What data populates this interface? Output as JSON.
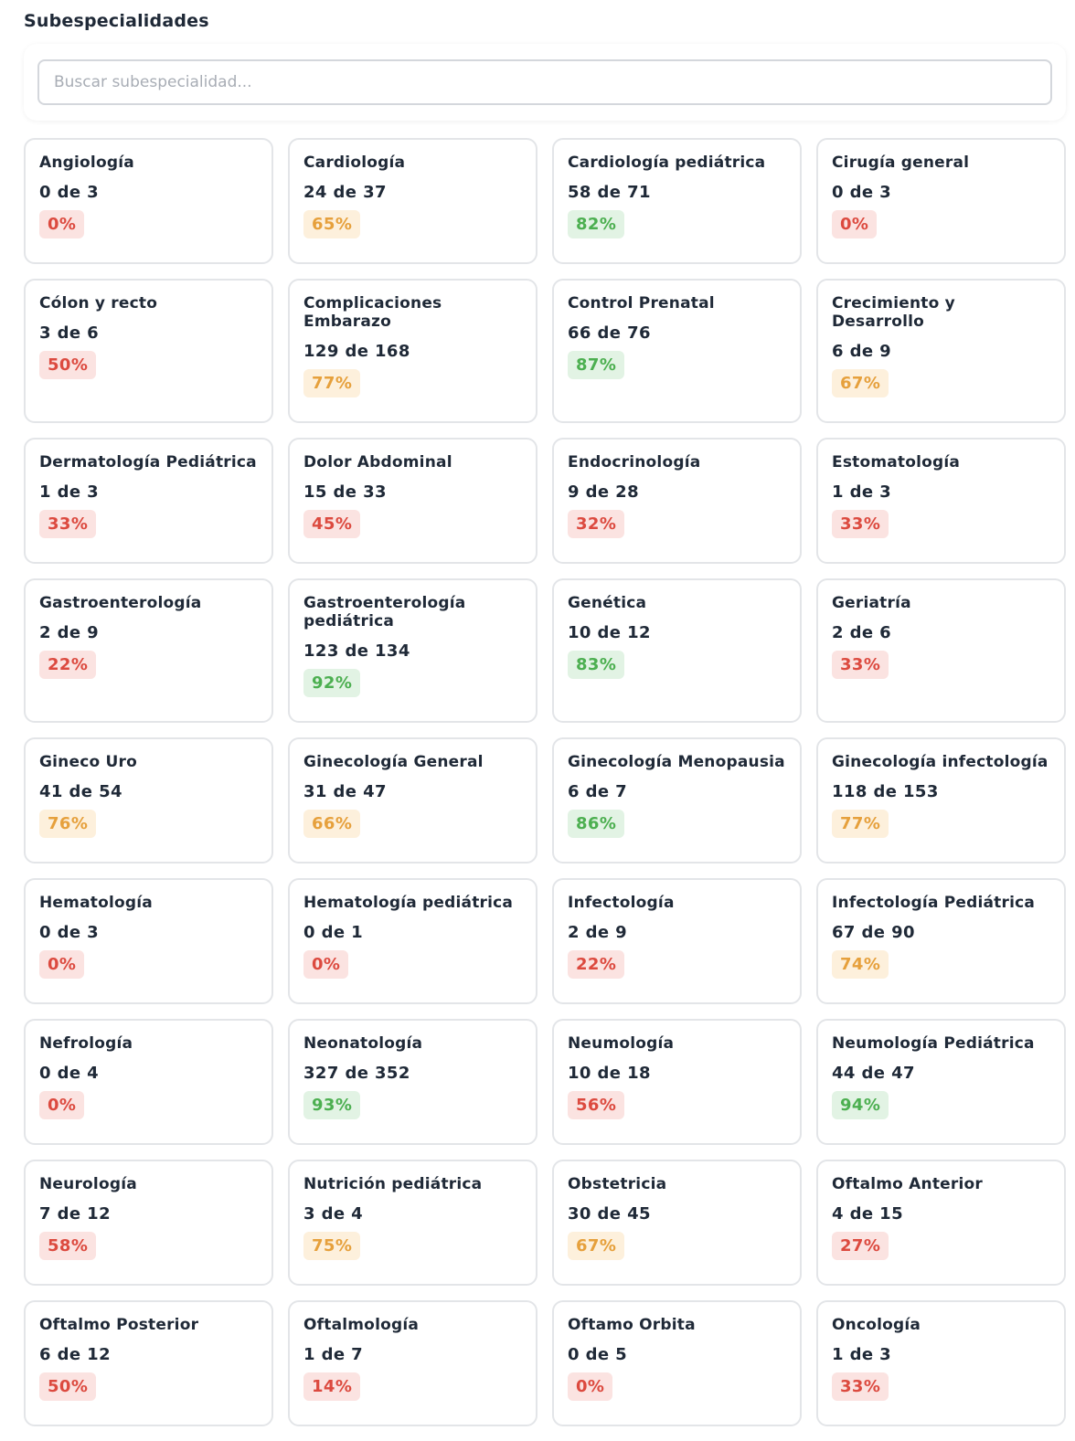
{
  "page": {
    "title": "Subespecialidades",
    "search_placeholder": "Buscar subespecialidad..."
  },
  "colors": {
    "red": "#dc4a3f",
    "orange": "#e6a03c",
    "green": "#4caf50"
  },
  "cards": [
    {
      "name": "Angiología",
      "count": "0 de 3",
      "percent": "0%",
      "status": "red"
    },
    {
      "name": "Cardiología",
      "count": "24 de 37",
      "percent": "65%",
      "status": "orange"
    },
    {
      "name": "Cardiología pediátrica",
      "count": "58 de 71",
      "percent": "82%",
      "status": "green"
    },
    {
      "name": "Cirugía general",
      "count": "0 de 3",
      "percent": "0%",
      "status": "red"
    },
    {
      "name": "Cólon y recto",
      "count": "3 de 6",
      "percent": "50%",
      "status": "red"
    },
    {
      "name": "Complicaciones Embarazo",
      "count": "129 de 168",
      "percent": "77%",
      "status": "orange"
    },
    {
      "name": "Control Prenatal",
      "count": "66 de 76",
      "percent": "87%",
      "status": "green"
    },
    {
      "name": "Crecimiento y Desarrollo",
      "count": "6 de 9",
      "percent": "67%",
      "status": "orange"
    },
    {
      "name": "Dermatología Pediátrica",
      "count": "1 de 3",
      "percent": "33%",
      "status": "red"
    },
    {
      "name": "Dolor Abdominal",
      "count": "15 de 33",
      "percent": "45%",
      "status": "red"
    },
    {
      "name": "Endocrinología",
      "count": "9 de 28",
      "percent": "32%",
      "status": "red"
    },
    {
      "name": "Estomatología",
      "count": "1 de 3",
      "percent": "33%",
      "status": "red"
    },
    {
      "name": "Gastroenterología",
      "count": "2 de 9",
      "percent": "22%",
      "status": "red"
    },
    {
      "name": "Gastroenterología pediátrica",
      "count": "123 de 134",
      "percent": "92%",
      "status": "green"
    },
    {
      "name": "Genética",
      "count": "10 de 12",
      "percent": "83%",
      "status": "green"
    },
    {
      "name": "Geriatría",
      "count": "2 de 6",
      "percent": "33%",
      "status": "red"
    },
    {
      "name": "Gineco Uro",
      "count": "41 de 54",
      "percent": "76%",
      "status": "orange"
    },
    {
      "name": "Ginecología General",
      "count": "31 de 47",
      "percent": "66%",
      "status": "orange"
    },
    {
      "name": "Ginecología Menopausia",
      "count": "6 de 7",
      "percent": "86%",
      "status": "green"
    },
    {
      "name": "Ginecología infectología",
      "count": "118 de 153",
      "percent": "77%",
      "status": "orange"
    },
    {
      "name": "Hematología",
      "count": "0 de 3",
      "percent": "0%",
      "status": "red"
    },
    {
      "name": "Hematología pediátrica",
      "count": "0 de 1",
      "percent": "0%",
      "status": "red"
    },
    {
      "name": "Infectología",
      "count": "2 de 9",
      "percent": "22%",
      "status": "red"
    },
    {
      "name": "Infectología Pediátrica",
      "count": "67 de 90",
      "percent": "74%",
      "status": "orange"
    },
    {
      "name": "Nefrología",
      "count": "0 de 4",
      "percent": "0%",
      "status": "red"
    },
    {
      "name": "Neonatología",
      "count": "327 de 352",
      "percent": "93%",
      "status": "green"
    },
    {
      "name": "Neumología",
      "count": "10 de 18",
      "percent": "56%",
      "status": "red"
    },
    {
      "name": "Neumología Pediátrica",
      "count": "44 de 47",
      "percent": "94%",
      "status": "green"
    },
    {
      "name": "Neurología",
      "count": "7 de 12",
      "percent": "58%",
      "status": "red"
    },
    {
      "name": "Nutrición pediátrica",
      "count": "3 de 4",
      "percent": "75%",
      "status": "orange"
    },
    {
      "name": "Obstetricia",
      "count": "30 de 45",
      "percent": "67%",
      "status": "orange"
    },
    {
      "name": "Oftalmo Anterior",
      "count": "4 de 15",
      "percent": "27%",
      "status": "red"
    },
    {
      "name": "Oftalmo Posterior",
      "count": "6 de 12",
      "percent": "50%",
      "status": "red"
    },
    {
      "name": "Oftalmología",
      "count": "1 de 7",
      "percent": "14%",
      "status": "red"
    },
    {
      "name": "Oftamo Orbita",
      "count": "0 de 5",
      "percent": "0%",
      "status": "red"
    },
    {
      "name": "Oncología",
      "count": "1 de 3",
      "percent": "33%",
      "status": "red"
    }
  ]
}
